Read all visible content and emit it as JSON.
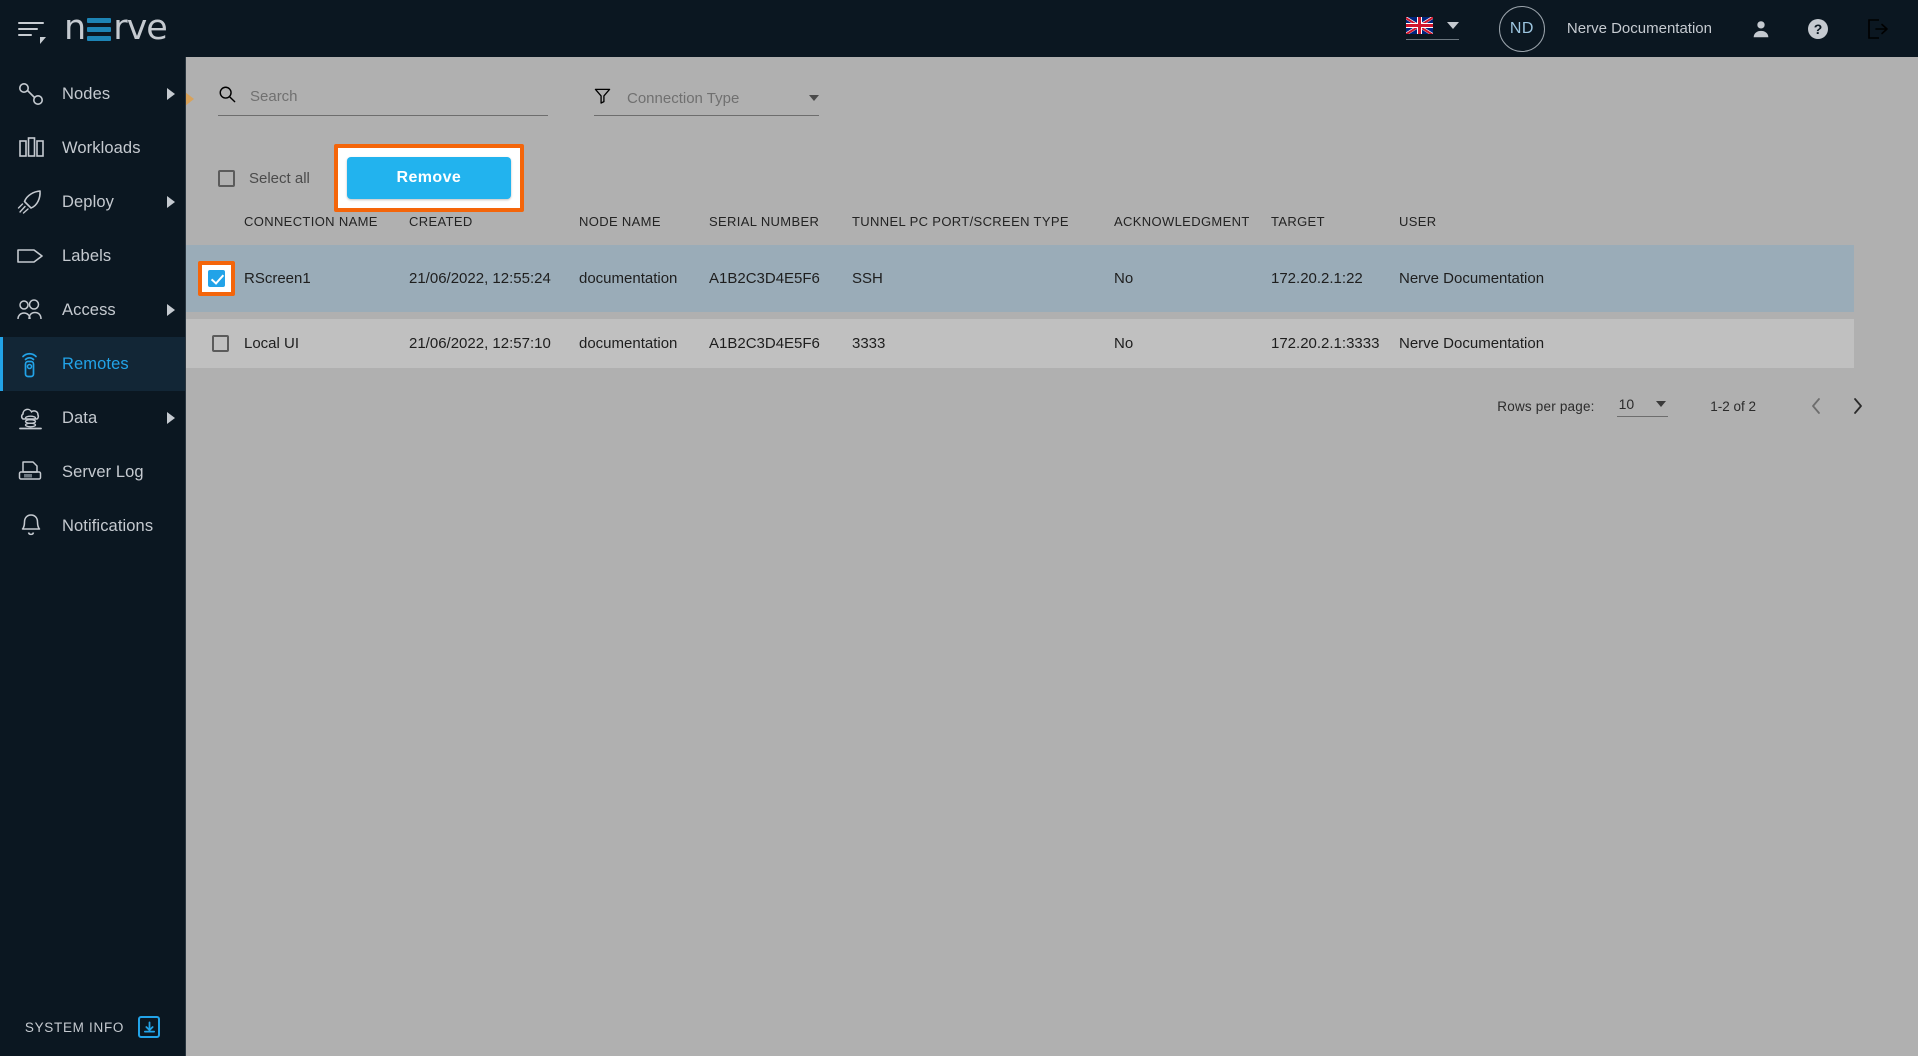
{
  "header": {
    "logo_text_1": "n",
    "logo_text_2": "rve",
    "menu_icon": "hamburger-icon",
    "language": "English (UK)",
    "avatar_initials": "ND",
    "user_name": "Nerve Documentation",
    "profile_icon": "person-icon",
    "help_icon": "help-circle-icon",
    "logout_icon": "logout-icon"
  },
  "sidebar": {
    "items": [
      {
        "label": "Nodes",
        "icon": "nodes-icon",
        "has_arrow": true,
        "active": false
      },
      {
        "label": "Workloads",
        "icon": "workloads-icon",
        "has_arrow": false,
        "active": false
      },
      {
        "label": "Deploy",
        "icon": "deploy-rocket-icon",
        "has_arrow": true,
        "active": false
      },
      {
        "label": "Labels",
        "icon": "label-tag-icon",
        "has_arrow": false,
        "active": false
      },
      {
        "label": "Access",
        "icon": "users-icon",
        "has_arrow": true,
        "active": false
      },
      {
        "label": "Remotes",
        "icon": "remote-control-icon",
        "has_arrow": false,
        "active": true
      },
      {
        "label": "Data",
        "icon": "cloud-database-icon",
        "has_arrow": true,
        "active": false
      },
      {
        "label": "Server Log",
        "icon": "server-log-icon",
        "has_arrow": false,
        "active": false
      },
      {
        "label": "Notifications",
        "icon": "bell-icon",
        "has_arrow": false,
        "active": false
      }
    ],
    "footer": {
      "label": "SYSTEM INFO",
      "icon": "download-box-icon"
    }
  },
  "toolbar": {
    "search_placeholder": "Search",
    "search_value": "",
    "search_icon": "search-icon",
    "filter_icon": "funnel-filter-icon",
    "connection_type_placeholder": "Connection Type",
    "connection_type_value": "",
    "select_all_label": "Select all",
    "select_all_checked": false,
    "remove_label": "Remove"
  },
  "table": {
    "columns": [
      "CONNECTION NAME",
      "CREATED",
      "NODE NAME",
      "SERIAL NUMBER",
      "TUNNEL PC PORT/SCREEN TYPE",
      "ACKNOWLEDGMENT",
      "TARGET",
      "USER"
    ],
    "rows": [
      {
        "selected": true,
        "connection_name": "RScreen1",
        "created": "21/06/2022, 12:55:24",
        "node_name": "documentation",
        "serial_number": "A1B2C3D4E5F6",
        "tunnel_port": "SSH",
        "acknowledgment": "No",
        "target": "172.20.2.1:22",
        "user": "Nerve Documentation"
      },
      {
        "selected": false,
        "connection_name": "Local UI",
        "created": "21/06/2022, 12:57:10",
        "node_name": "documentation",
        "serial_number": "A1B2C3D4E5F6",
        "tunnel_port": "3333",
        "acknowledgment": "No",
        "target": "172.20.2.1:3333",
        "user": "Nerve Documentation"
      }
    ]
  },
  "pagination": {
    "rows_per_page_label": "Rows per page:",
    "rows_per_page_value": "10",
    "range_label": "1-2 of 2",
    "prev_icon": "chevron-left-icon",
    "next_icon": "chevron-right-icon"
  },
  "colors": {
    "accent_blue": "#22a3e8",
    "button_blue": "#22b3ee",
    "highlight_orange": "#f4650a",
    "sidebar_dark": "#0b1721",
    "main_grey": "#b0b0b0"
  }
}
